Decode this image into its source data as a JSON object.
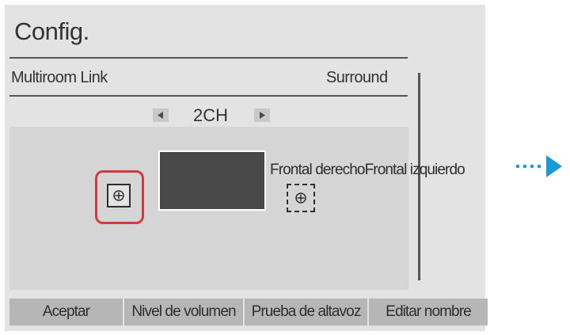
{
  "screen": {
    "title": "Config."
  },
  "setting": {
    "label": "Multiroom Link",
    "value": "Surround"
  },
  "mode_selector": {
    "value": "2CH",
    "prev_icon": "triangle-left-icon",
    "next_icon": "triangle-right-icon"
  },
  "speakers": {
    "label_right": "Frontal derecho",
    "label_left": "Frontal izquierdo",
    "icon": "speaker-plus-icon"
  },
  "buttons": {
    "accept": "Aceptar",
    "volume": "Nivel de volumen",
    "test": "Prueba de altavoz",
    "rename": "Editar nombre"
  },
  "colors": {
    "selection": "#cf3b3f",
    "next_arrow": "#1a9ad6",
    "panel": "#e3e3e3"
  }
}
